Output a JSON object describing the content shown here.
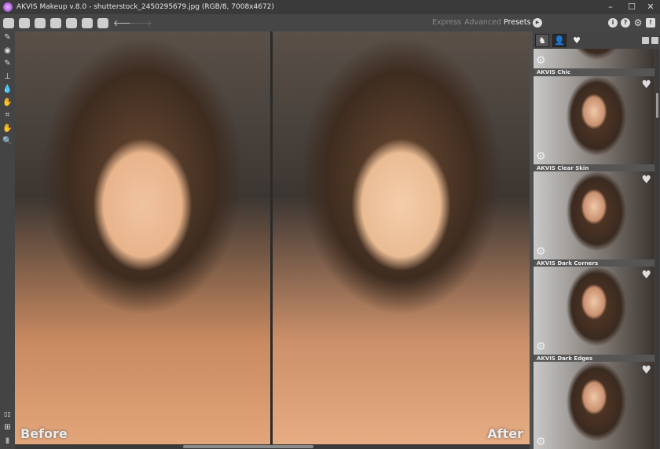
{
  "window": {
    "title": "AKVIS Makeup v.8.0 - shutterstock_2450295679.jpg (RGB/8, 7008x4672)",
    "minimize": "–",
    "maximize": "☐",
    "close": "✕"
  },
  "toolbar": {
    "icons": [
      "workspace-icon",
      "open-icon",
      "save-icon",
      "print-icon",
      "batch-icon",
      "import-presets-icon",
      "export-presets-icon",
      "undo-icon",
      "redo-icon"
    ],
    "undo": "🡐",
    "redo": "🡒",
    "modes": {
      "express": "Express",
      "advanced": "Advanced",
      "presets": "Presets"
    },
    "run": "▶",
    "info": "i",
    "help": "?",
    "settings": "⚙",
    "feedback": "!"
  },
  "left_tools": [
    "retouch-brush",
    "eye",
    "pencil",
    "stamp",
    "drop",
    "makeup-brush",
    "crop",
    "hand",
    "zoom"
  ],
  "left_tool_glyphs": [
    "✎",
    "◉",
    "✎",
    "⊥",
    "💧",
    "✋",
    "⌗",
    "✋",
    "🔍"
  ],
  "view_buttons": [
    "▯▯",
    "⊞",
    "▮"
  ],
  "canvas": {
    "before_label": "Before",
    "after_label": "After"
  },
  "panel": {
    "tabs": [
      "♞",
      "👤",
      "♥"
    ],
    "presets": [
      {
        "name": "AKVIS Chic"
      },
      {
        "name": "AKVIS Clear Skin"
      },
      {
        "name": "AKVIS Dark Corners"
      },
      {
        "name": "AKVIS Dark Edges"
      },
      {
        "name": ""
      }
    ],
    "gear": "⚙",
    "heart": "♥"
  }
}
